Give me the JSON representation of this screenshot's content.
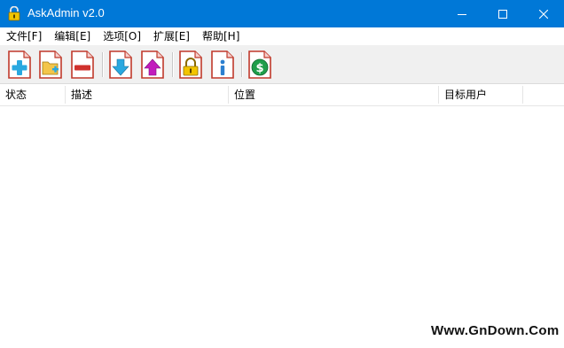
{
  "window": {
    "title": "AskAdmin v2.0",
    "titlebar_color": "#0078d7",
    "controls": [
      "minimize-icon",
      "maximize-icon",
      "close-icon"
    ]
  },
  "menu": {
    "items": [
      {
        "label": "文件[F]"
      },
      {
        "label": "编辑[E]"
      },
      {
        "label": "选项[O]"
      },
      {
        "label": "扩展[E]"
      },
      {
        "label": "帮助[H]"
      }
    ]
  },
  "toolbar": {
    "buttons": [
      {
        "icon": "add-icon"
      },
      {
        "icon": "add-folder-icon"
      },
      {
        "icon": "remove-icon"
      },
      {
        "icon": "import-down-arrow-icon"
      },
      {
        "icon": "export-up-arrow-icon"
      },
      {
        "icon": "lock-icon"
      },
      {
        "icon": "info-icon"
      },
      {
        "icon": "dollar-icon"
      }
    ]
  },
  "list": {
    "columns": [
      {
        "label": "状态"
      },
      {
        "label": "描述"
      },
      {
        "label": "位置"
      },
      {
        "label": "目标用户"
      }
    ],
    "rows": []
  },
  "watermark": {
    "text": "Www.GnDown.Com"
  }
}
